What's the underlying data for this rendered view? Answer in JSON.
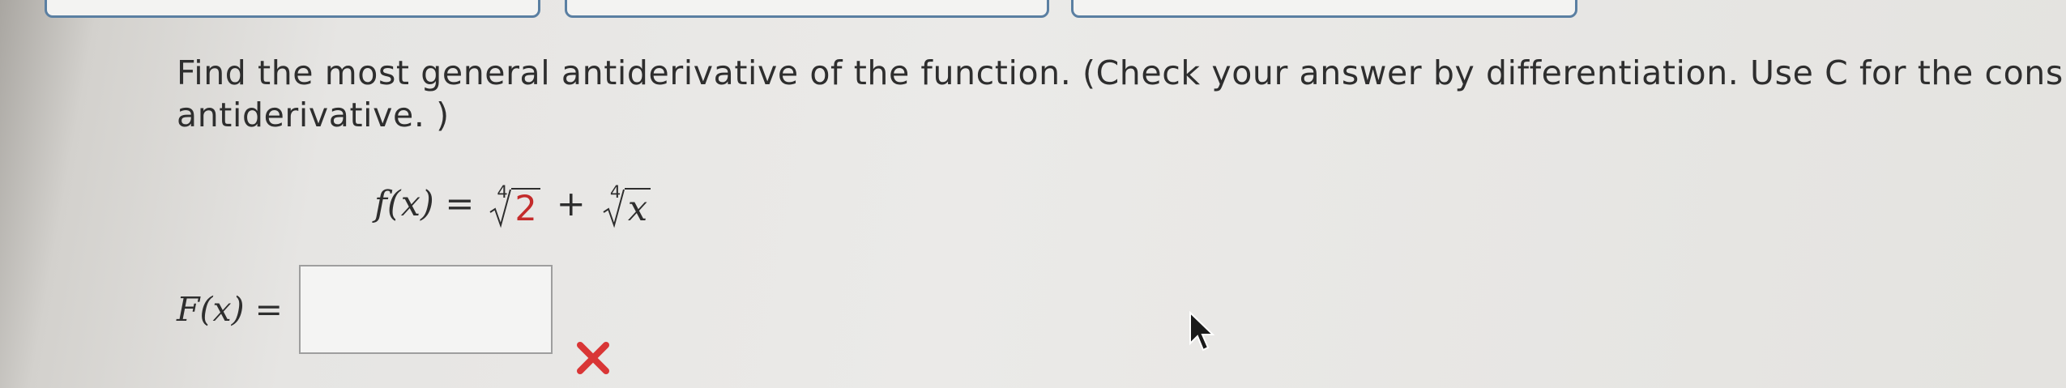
{
  "question": {
    "line1": "Find the most general antiderivative of the function. (Check your answer by differentiation. Use C for the cons",
    "line2": "antiderivative. )"
  },
  "given_function": {
    "lhs": "f(x) =",
    "term1_index": "4",
    "term1_radicand": "2",
    "operator": "+",
    "term2_index": "4",
    "term2_radicand": "x"
  },
  "answer": {
    "label": "F(x) =",
    "value": "",
    "status_icon": "x-mark-icon",
    "status_color": "#d93636"
  },
  "colors": {
    "tab_border": "#5a7fa2",
    "highlight_red": "#c42b2b"
  }
}
